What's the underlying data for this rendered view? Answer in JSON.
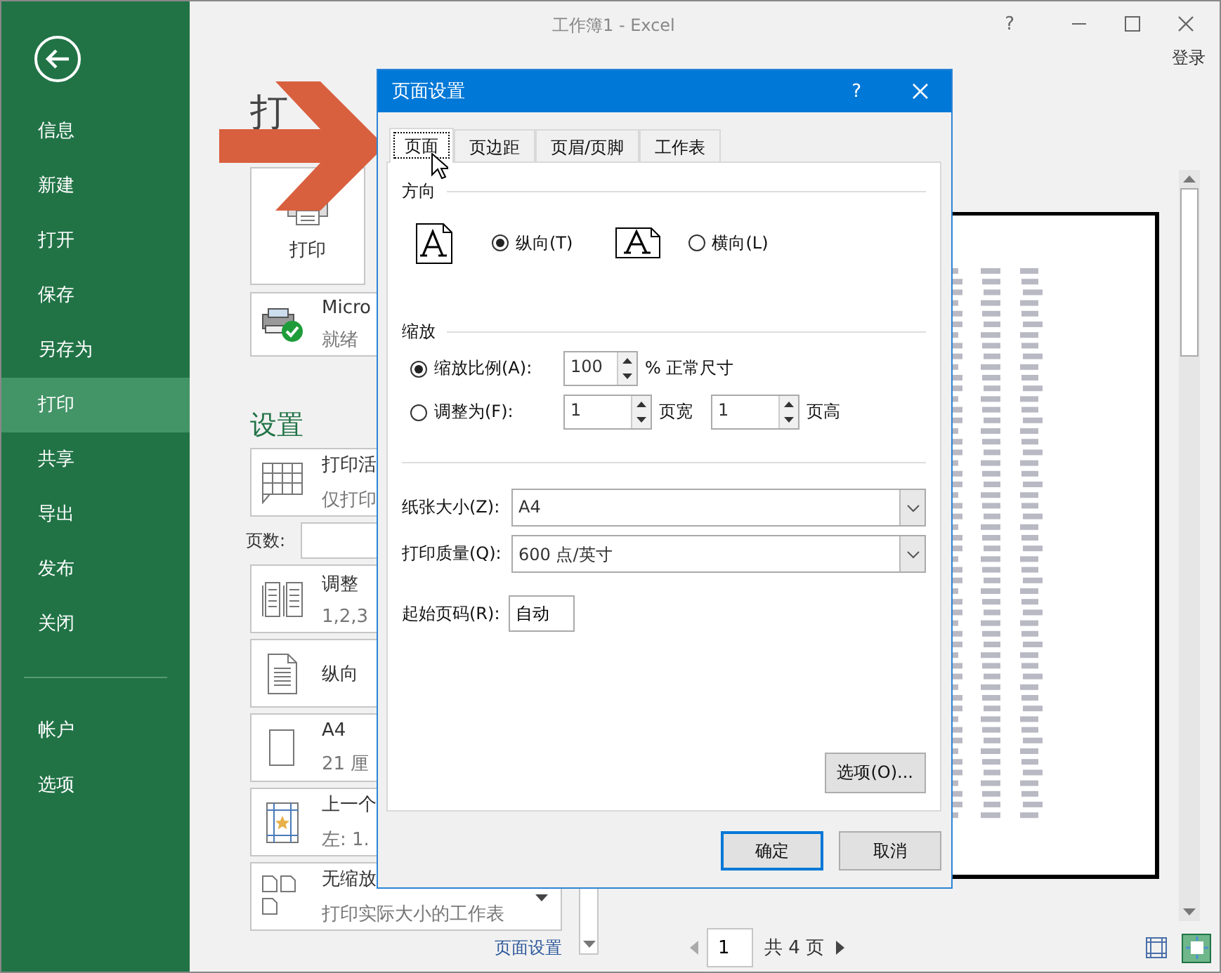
{
  "window": {
    "title": "工作簿1 - Excel",
    "help": "?",
    "sign_in": "登录"
  },
  "sidebar": {
    "items": [
      {
        "label": "信息",
        "selected": false
      },
      {
        "label": "新建",
        "selected": false
      },
      {
        "label": "打开",
        "selected": false
      },
      {
        "label": "保存",
        "selected": false
      },
      {
        "label": "另存为",
        "selected": false
      },
      {
        "label": "打印",
        "selected": true
      },
      {
        "label": "共享",
        "selected": false
      },
      {
        "label": "导出",
        "selected": false
      },
      {
        "label": "发布",
        "selected": false
      },
      {
        "label": "关闭",
        "selected": false
      }
    ],
    "footer_items": [
      {
        "label": "帐户",
        "selected": false
      },
      {
        "label": "选项",
        "selected": false
      }
    ]
  },
  "print": {
    "heading": "打",
    "button": "打印",
    "printer": {
      "name": "Micro",
      "status": "就绪"
    }
  },
  "settings": {
    "heading": "设置",
    "items": [
      {
        "kind": "sheets",
        "title": "打印活",
        "subtitle": "仅打印"
      },
      {
        "kind": "pages",
        "label": "页数:"
      },
      {
        "kind": "collate",
        "title": "调整",
        "subtitle": "1,2,3"
      },
      {
        "kind": "orientation",
        "title": "纵向"
      },
      {
        "kind": "paper",
        "title": "A4",
        "subtitle": "21 厘"
      },
      {
        "kind": "margins",
        "title": "上一个",
        "subtitle": "左: 1."
      },
      {
        "kind": "scaling",
        "title": "无缩放",
        "subtitle": "打印实际大小的工作表"
      }
    ],
    "page_setup_link": "页面设置"
  },
  "preview": {
    "page": "1",
    "total": "共 4 页",
    "view_buttons": [
      {
        "selected": false
      },
      {
        "selected": true
      }
    ]
  },
  "dialog": {
    "title": "页面设置",
    "help": "?",
    "tabs": [
      {
        "label": "页面",
        "selected": true
      },
      {
        "label": "页边距",
        "selected": false
      },
      {
        "label": "页眉/页脚",
        "selected": false
      },
      {
        "label": "工作表",
        "selected": false
      }
    ],
    "orientation": {
      "heading": "方向",
      "options": [
        {
          "kind": "portrait",
          "label": "纵向(T)",
          "selected": true
        },
        {
          "kind": "landscape",
          "label": "横向(L)",
          "selected": false
        }
      ]
    },
    "scaling": {
      "heading": "缩放",
      "options": [
        {
          "kind": "percent",
          "label": "缩放比例(A):",
          "selected": true,
          "value": "100",
          "suffix": "% 正常尺寸"
        },
        {
          "kind": "fit",
          "label": "调整为(F):",
          "selected": false,
          "wide": "1",
          "wide_label": "页宽",
          "tall": "1",
          "tall_label": "页高"
        }
      ]
    },
    "paper_size": {
      "label": "纸张大小(Z):",
      "value": "A4"
    },
    "print_quality": {
      "label": "打印质量(Q):",
      "value": "600 点/英寸"
    },
    "first_page": {
      "label": "起始页码(R):",
      "value": "自动"
    },
    "options_button": "选项(O)...",
    "buttons": [
      "确定",
      "取消"
    ]
  }
}
